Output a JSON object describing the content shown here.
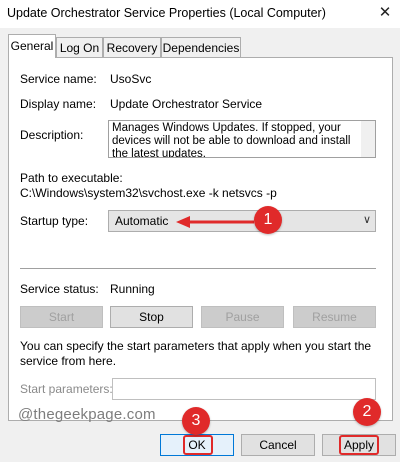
{
  "window": {
    "title": "Update Orchestrator Service Properties (Local Computer)",
    "close_glyph": "✕"
  },
  "tabs": [
    {
      "label": "General",
      "active": true
    },
    {
      "label": "Log On"
    },
    {
      "label": "Recovery"
    },
    {
      "label": "Dependencies"
    }
  ],
  "service": {
    "name_label": "Service name:",
    "name_value": "UsoSvc",
    "display_label": "Display name:",
    "display_value": "Update Orchestrator Service",
    "description_label": "Description:",
    "description_value": "Manages Windows Updates. If stopped, your devices will not be able to download and install the latest updates.",
    "path_label": "Path to executable:",
    "path_value": "C:\\Windows\\system32\\svchost.exe -k netsvcs -p",
    "startup_label": "Startup type:",
    "startup_value": "Automatic",
    "status_label": "Service status:",
    "status_value": "Running"
  },
  "control_buttons": {
    "start": "Start",
    "stop": "Stop",
    "pause": "Pause",
    "resume": "Resume"
  },
  "params": {
    "info_text": "You can specify the start parameters that apply when you start the service from here.",
    "label": "Start parameters:",
    "value": ""
  },
  "watermark": "@thegeekpage.com",
  "footer": {
    "ok": "OK",
    "cancel": "Cancel",
    "apply": "Apply"
  },
  "annotations": {
    "badge1": "1",
    "badge2": "2",
    "badge3": "3",
    "color": "#e02a2a"
  }
}
